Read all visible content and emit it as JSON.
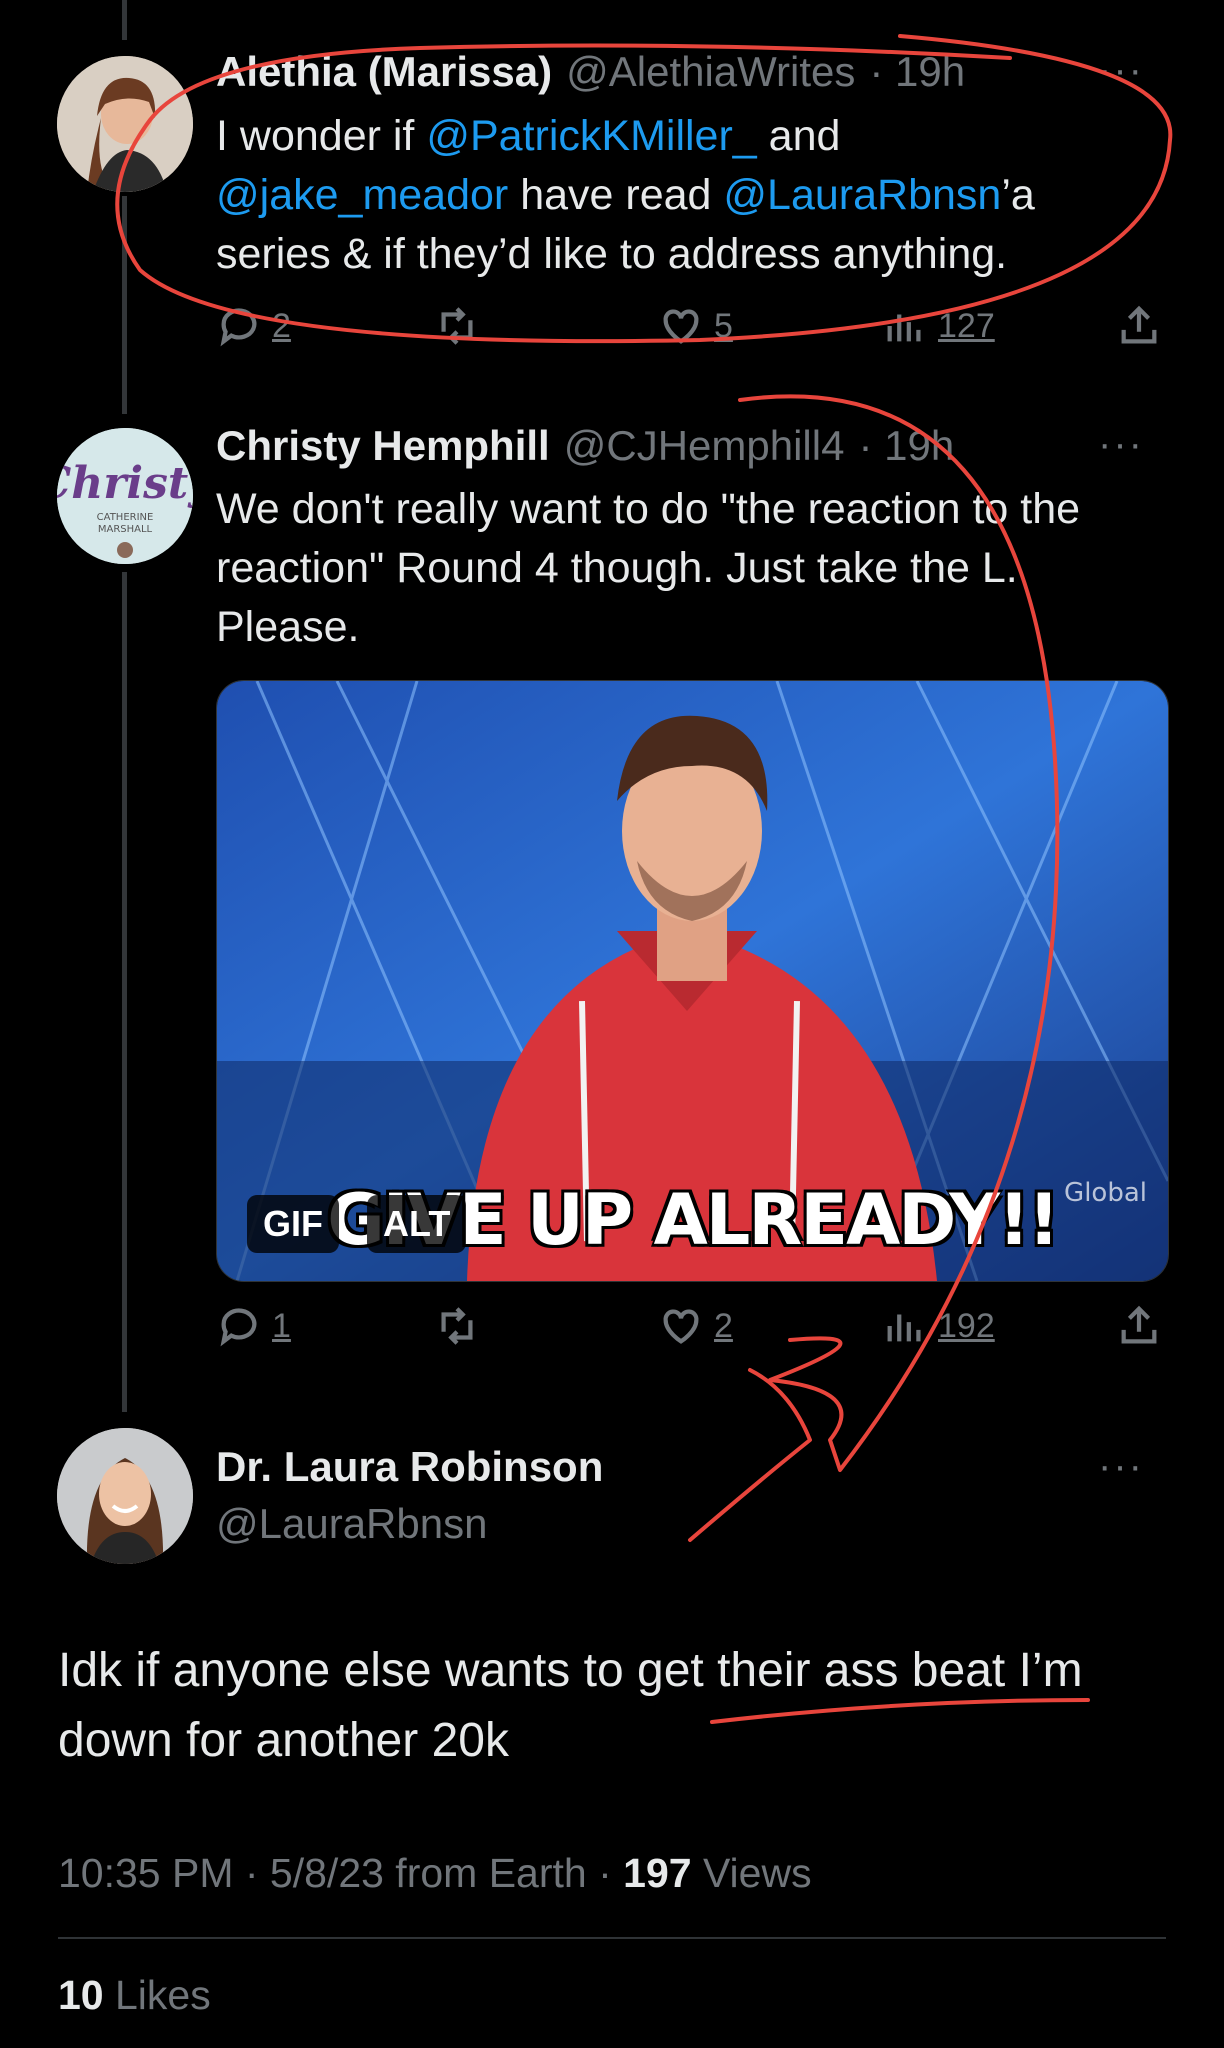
{
  "tweets": [
    {
      "name": "Alethia (Marissa)",
      "handle": "@AlethiaWrites",
      "time": "· 19h",
      "text_parts": [
        "I wonder if ",
        "@PatrickKMiller_",
        " and ",
        "@jake_meador",
        " have read ",
        "@LauraRbnsn",
        "’a series & if they’d like to address anything."
      ],
      "replies": "2",
      "likes": "5",
      "views": "127"
    },
    {
      "name": "Christy Hemphill",
      "handle": "@CJHemphill4",
      "time": "· 19h",
      "text": "We don't really want to do \"the reaction to the reaction\" Round 4 though. Just take the L. Please.",
      "media": {
        "gif_badge": "GIF",
        "alt_badge": "ALT",
        "caption": "GIVE UP ALREADY!!",
        "watermark": "Global"
      },
      "replies": "1",
      "likes": "2",
      "views": "192"
    }
  ],
  "main_tweet": {
    "name": "Dr. Laura Robinson",
    "handle": "@LauraRbnsn",
    "text": "Idk if anyone else wants to get their ass beat I’m down for another 20k",
    "time": "10:35 PM · 5/8/23 from Earth · ",
    "views_count": "197",
    "views_label": " Views",
    "likes_count": "10",
    "likes_label": " Likes"
  },
  "icons": {
    "more": "···"
  },
  "colors": {
    "background": "#000000",
    "text": "#e7e9ea",
    "secondary": "#71767b",
    "mention": "#1d9bf0",
    "annotation": "#e8453c"
  }
}
